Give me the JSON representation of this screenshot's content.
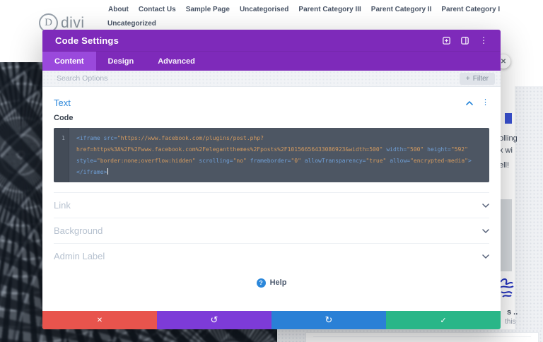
{
  "nav": {
    "logo_letter": "D",
    "logo_text": "divi",
    "items_row1": [
      "About",
      "Contact Us",
      "Sample Page",
      "Uncategorised",
      "Parent Category III",
      "Parent Category II",
      "Parent Category I"
    ],
    "items_row2": [
      "Uncategorized"
    ]
  },
  "page_background": {
    "close_glyph": "✕",
    "fragments": {
      "f1": "olling",
      "f2": "x wi",
      "f3": "ell!",
      "f4": "s ..",
      "f5": "this"
    }
  },
  "modal": {
    "title": "Code Settings",
    "header_icons": [
      "expand-icon",
      "split-view-icon",
      "more-options-icon"
    ],
    "header_dots_glyph": "⋮",
    "tabs": [
      {
        "label": "Content",
        "active": true
      },
      {
        "label": "Design",
        "active": false
      },
      {
        "label": "Advanced",
        "active": false
      }
    ],
    "search": {
      "placeholder": "Search Options",
      "filter_plus": "+",
      "filter_label": "Filter"
    },
    "text_section": {
      "title": "Text",
      "field_label": "Code",
      "dots_glyph": "⋮"
    },
    "collapsed_sections": [
      "Link",
      "Background",
      "Admin Label"
    ],
    "help": {
      "icon_glyph": "?",
      "label": "Help"
    },
    "actions": [
      {
        "name": "discard",
        "glyph": "✕",
        "color": "#e8544d"
      },
      {
        "name": "undo",
        "glyph": "↺",
        "color": "#7d3bd8"
      },
      {
        "name": "redo",
        "glyph": "↻",
        "color": "#2a80d6"
      },
      {
        "name": "save",
        "glyph": "✓",
        "color": "#29b688"
      }
    ]
  },
  "code_editor": {
    "line_number": "1",
    "full_code": "<iframe src=\"https://www.facebook.com/plugins/post.php?href=https%3A%2F%2Fwww.facebook.com%2Felegantthemes%2Fposts%2F10156656433086923&width=500\" width=\"500\" height=\"592\" style=\"border:none;overflow:hidden\" scrolling=\"no\" frameborder=\"0\" allowTransparency=\"true\" allow=\"encrypted-media\"></iframe>",
    "syntax_colors": {
      "tag": "#6f9fd6",
      "string": "#d39a5f",
      "background": "#4d5663"
    },
    "lines": [
      [
        {
          "t": "tag",
          "s": "<iframe"
        },
        {
          "t": "plain",
          "s": " "
        },
        {
          "t": "attr",
          "s": "src="
        },
        {
          "t": "str",
          "s": "\"https://www.facebook.com/plugins/post.php?"
        }
      ],
      [
        {
          "t": "str",
          "s": "href=https%3A%2F%2Fwww.facebook.com%2Felegantthemes%2Fposts%2F10156656433086923&width=500\""
        },
        {
          "t": "plain",
          "s": " "
        },
        {
          "t": "attr",
          "s": "width="
        },
        {
          "t": "str",
          "s": "\"500\""
        },
        {
          "t": "plain",
          "s": " "
        },
        {
          "t": "attr",
          "s": "height="
        },
        {
          "t": "str",
          "s": "\"592\""
        }
      ],
      [
        {
          "t": "attr",
          "s": "style="
        },
        {
          "t": "str",
          "s": "\"border:none;overflow:hidden\""
        },
        {
          "t": "plain",
          "s": " "
        },
        {
          "t": "attr",
          "s": "scrolling="
        },
        {
          "t": "str",
          "s": "\"no\""
        },
        {
          "t": "plain",
          "s": " "
        },
        {
          "t": "attr",
          "s": "frameborder="
        },
        {
          "t": "str",
          "s": "\"0\""
        },
        {
          "t": "plain",
          "s": " "
        },
        {
          "t": "attr",
          "s": "allowTransparency="
        },
        {
          "t": "str",
          "s": "\"true\""
        },
        {
          "t": "plain",
          "s": " "
        },
        {
          "t": "attr",
          "s": "allow="
        },
        {
          "t": "str",
          "s": "\"encrypted-media\""
        },
        {
          "t": "tag",
          "s": ">"
        }
      ],
      [
        {
          "t": "tag",
          "s": "</iframe>"
        },
        {
          "t": "cursor",
          "s": ""
        }
      ]
    ]
  },
  "colors": {
    "modal_purple": "#7e2aba",
    "active_tab_purple": "#9a49dc",
    "accent_blue": "#2b87da"
  }
}
